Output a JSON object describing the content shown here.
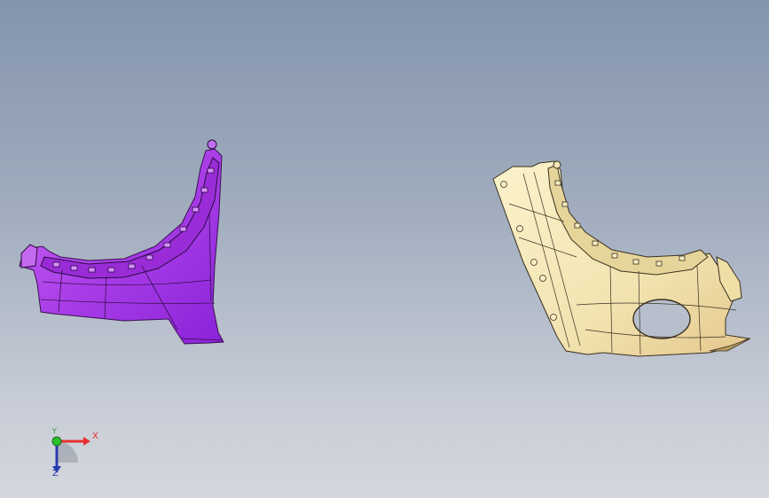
{
  "viewport": {
    "background_top": "#8394ac",
    "background_bottom": "#d4d7de"
  },
  "parts": [
    {
      "name": "front-fender-panel",
      "color": "#b23ee8"
    },
    {
      "name": "rear-fender-panel",
      "color": "#f3e6b4"
    }
  ],
  "triad": {
    "x_label": "X",
    "y_label": "Y",
    "z_label": "Z",
    "x_color": "#e83030",
    "y_color": "#2a9a2a",
    "z_color": "#2a3ab0"
  }
}
